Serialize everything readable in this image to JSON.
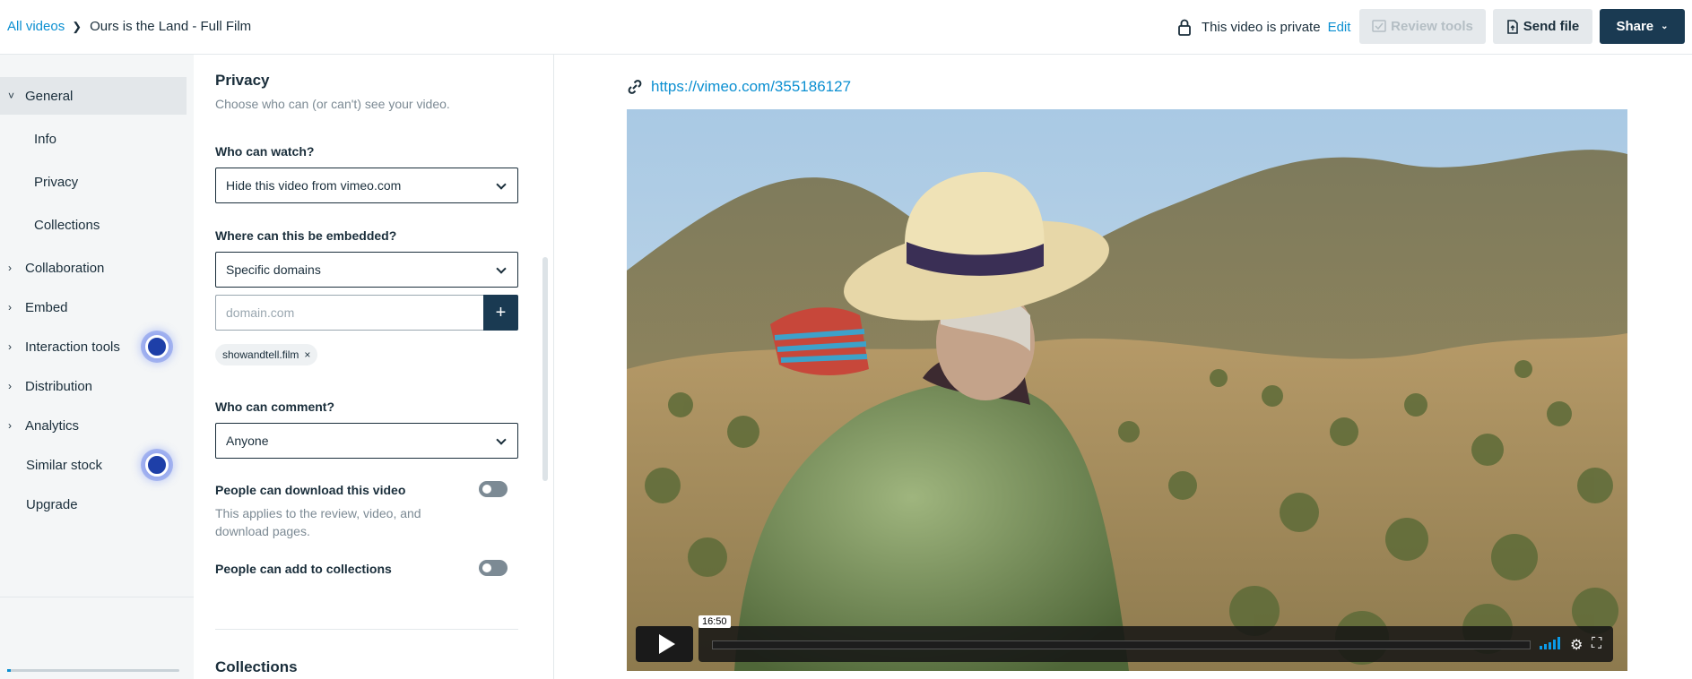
{
  "header": {
    "breadcrumb_root": "All videos",
    "breadcrumb_current": "Ours is the Land - Full Film",
    "privacy_text": "This video is private",
    "privacy_edit": "Edit",
    "review_tools": "Review tools",
    "send_file": "Send file",
    "share": "Share"
  },
  "sidebar": {
    "general": "General",
    "info": "Info",
    "privacy": "Privacy",
    "collections": "Collections",
    "collaboration": "Collaboration",
    "embed": "Embed",
    "interaction_tools": "Interaction tools",
    "distribution": "Distribution",
    "analytics": "Analytics",
    "similar_stock": "Similar stock",
    "upgrade": "Upgrade"
  },
  "privacy_panel": {
    "title": "Privacy",
    "subtitle": "Choose who can (or can't) see your video.",
    "who_watch_label": "Who can watch?",
    "who_watch_value": "Hide this video from vimeo.com",
    "embed_label": "Where can this be embedded?",
    "embed_value": "Specific domains",
    "domain_placeholder": "domain.com",
    "domain_chip": "showandtell.film",
    "comment_label": "Who can comment?",
    "comment_value": "Anyone",
    "download_label": "People can download this video",
    "download_desc": "This applies to the review, video, and download pages.",
    "collections_toggle_label": "People can add to collections",
    "collections_title": "Collections"
  },
  "video": {
    "url": "https://vimeo.com/355186127",
    "time": "16:50"
  }
}
